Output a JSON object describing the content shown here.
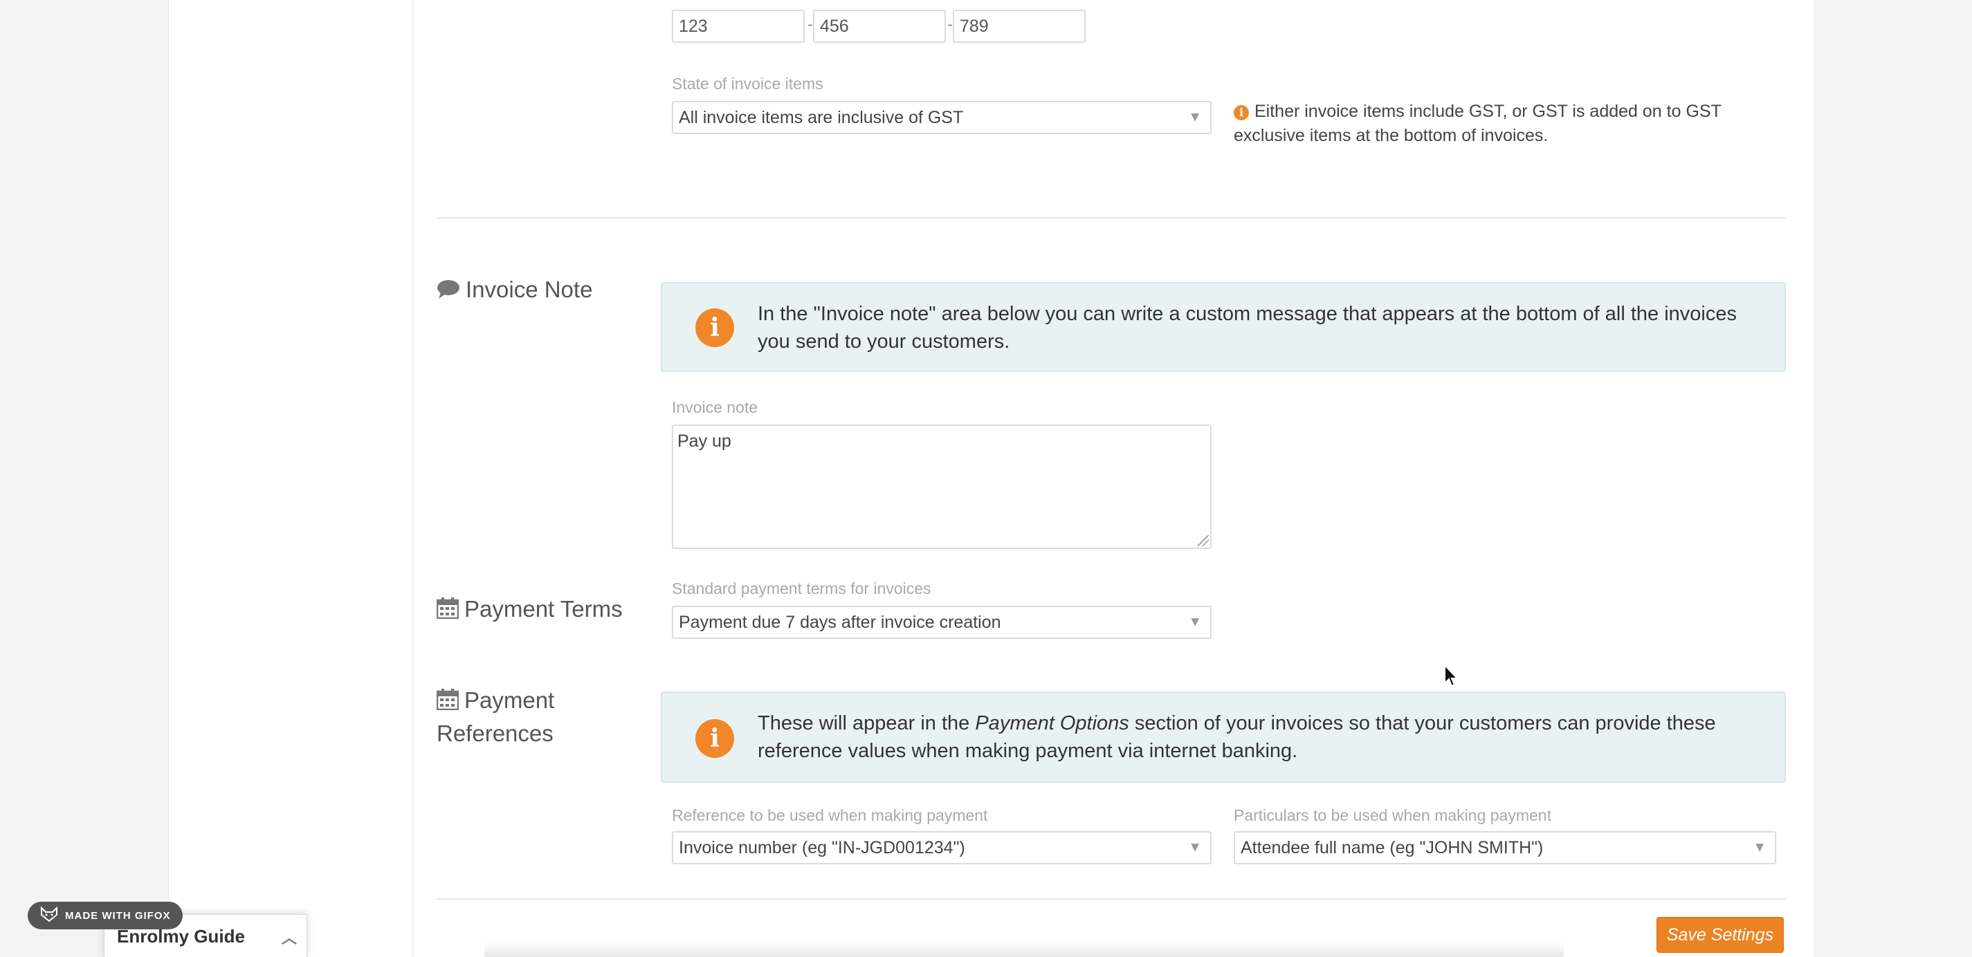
{
  "phone": {
    "part1": "123",
    "part2": "456",
    "part3": "789",
    "separator": "-"
  },
  "gst": {
    "label": "State of invoice items",
    "value": "All invoice items are inclusive of GST",
    "hint": "Either invoice items include GST, or GST is added on to GST exclusive items at the bottom of invoices."
  },
  "invoice_note": {
    "section_title": "Invoice Note",
    "info": "In the \"Invoice note\" area below you can write a custom message that appears at the bottom of all the invoices you send to your customers.",
    "label": "Invoice note",
    "value": "Pay up"
  },
  "payment_terms": {
    "section_title": "Payment Terms",
    "label": "Standard payment terms for invoices",
    "value": "Payment due 7 days after invoice creation"
  },
  "payment_references": {
    "section_title_line1": "Payment",
    "section_title_line2": "References",
    "info_before": "These will appear in the ",
    "info_italic": "Payment Options",
    "info_after": " section of your invoices so that your customers can provide these reference values when making payment via internet banking.",
    "reference_label": "Reference to be used when making payment",
    "reference_value": "Invoice number (eg \"IN-JGD001234\")",
    "particulars_label": "Particulars to be used when making payment",
    "particulars_value": "Attendee full name (eg \"JOHN SMITH\")"
  },
  "actions": {
    "save_label": "Save Settings"
  },
  "overlay": {
    "gifox_badge": "MADE WITH GIFOX",
    "guide_title": "Enrolmy Guide"
  },
  "icons": {
    "chevron": "chevron-down-icon",
    "comment": "comment-icon",
    "calendar": "calendar-icon",
    "info": "info-icon"
  },
  "colors": {
    "accent": "#ec8322",
    "info_bg": "#e9f2f3"
  }
}
